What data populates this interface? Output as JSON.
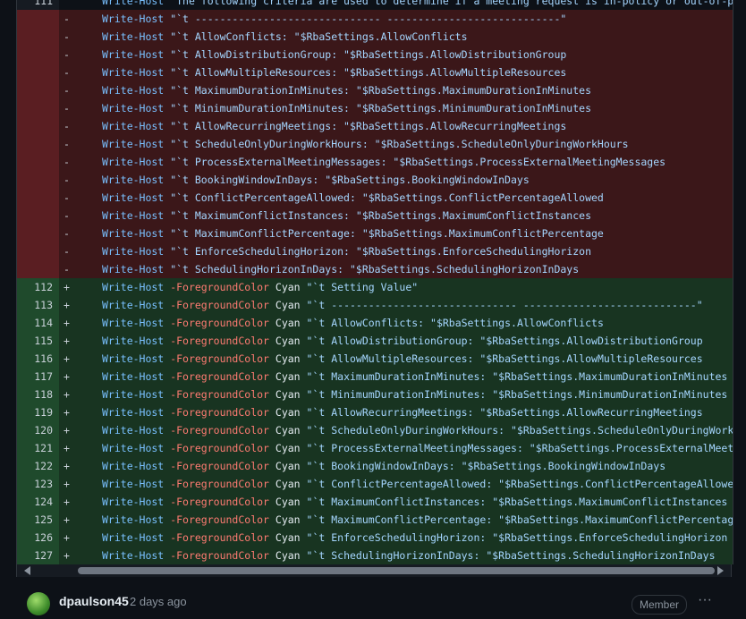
{
  "diff": {
    "rows": [
      {
        "type": "ctx",
        "num": "111",
        "sign": "",
        "cmd": "Write-Host",
        "param": "",
        "text": "",
        "str": "\"The following criteria are used to determine if a meeting request is in-policy or out-of-policy"
      },
      {
        "type": "del",
        "num": "",
        "sign": "-",
        "cmd": "Write-Host",
        "param": "",
        "text": "",
        "str": "\"`t ------------------------------  ----------------------------\""
      },
      {
        "type": "del",
        "num": "",
        "sign": "-",
        "cmd": "Write-Host",
        "param": "",
        "text": "",
        "str": "\"`t AllowConflicts:                 \"$RbaSettings.AllowConflicts"
      },
      {
        "type": "del",
        "num": "",
        "sign": "-",
        "cmd": "Write-Host",
        "param": "",
        "text": "",
        "str": "\"`t AllowDistributionGroup:         \"$RbaSettings.AllowDistributionGroup"
      },
      {
        "type": "del",
        "num": "",
        "sign": "-",
        "cmd": "Write-Host",
        "param": "",
        "text": "",
        "str": "\"`t AllowMultipleResources:         \"$RbaSettings.AllowMultipleResources"
      },
      {
        "type": "del",
        "num": "",
        "sign": "-",
        "cmd": "Write-Host",
        "param": "",
        "text": "",
        "str": "\"`t MaximumDurationInMinutes:       \"$RbaSettings.MaximumDurationInMinutes"
      },
      {
        "type": "del",
        "num": "",
        "sign": "-",
        "cmd": "Write-Host",
        "param": "",
        "text": "",
        "str": "\"`t MinimumDurationInMinutes:       \"$RbaSettings.MinimumDurationInMinutes"
      },
      {
        "type": "del",
        "num": "",
        "sign": "-",
        "cmd": "Write-Host",
        "param": "",
        "text": "",
        "str": "\"`t AllowRecurringMeetings:         \"$RbaSettings.AllowRecurringMeetings"
      },
      {
        "type": "del",
        "num": "",
        "sign": "-",
        "cmd": "Write-Host",
        "param": "",
        "text": "",
        "str": "\"`t ScheduleOnlyDuringWorkHours:    \"$RbaSettings.ScheduleOnlyDuringWorkHours"
      },
      {
        "type": "del",
        "num": "",
        "sign": "-",
        "cmd": "Write-Host",
        "param": "",
        "text": "",
        "str": "\"`t ProcessExternalMeetingMessages: \"$RbaSettings.ProcessExternalMeetingMessages"
      },
      {
        "type": "del",
        "num": "",
        "sign": "-",
        "cmd": "Write-Host",
        "param": "",
        "text": "",
        "str": "\"`t BookingWindowInDays:            \"$RbaSettings.BookingWindowInDays"
      },
      {
        "type": "del",
        "num": "",
        "sign": "-",
        "cmd": "Write-Host",
        "param": "",
        "text": "",
        "str": "\"`t ConflictPercentageAllowed:      \"$RbaSettings.ConflictPercentageAllowed"
      },
      {
        "type": "del",
        "num": "",
        "sign": "-",
        "cmd": "Write-Host",
        "param": "",
        "text": "",
        "str": "\"`t MaximumConflictInstances:       \"$RbaSettings.MaximumConflictInstances"
      },
      {
        "type": "del",
        "num": "",
        "sign": "-",
        "cmd": "Write-Host",
        "param": "",
        "text": "",
        "str": "\"`t MaximumConflictPercentage:      \"$RbaSettings.MaximumConflictPercentage"
      },
      {
        "type": "del",
        "num": "",
        "sign": "-",
        "cmd": "Write-Host",
        "param": "",
        "text": "",
        "str": "\"`t EnforceSchedulingHorizon:       \"$RbaSettings.EnforceSchedulingHorizon"
      },
      {
        "type": "del",
        "num": "",
        "sign": "-",
        "cmd": "Write-Host",
        "param": "",
        "text": "",
        "str": "\"`t SchedulingHorizonInDays:        \"$RbaSettings.SchedulingHorizonInDays"
      },
      {
        "type": "add",
        "num": "112",
        "sign": "+",
        "cmd": "Write-Host",
        "param": "-ForegroundColor",
        "text": "Cyan",
        "str": "\"`t Setting                        Value\""
      },
      {
        "type": "add",
        "num": "113",
        "sign": "+",
        "cmd": "Write-Host",
        "param": "-ForegroundColor",
        "text": "Cyan",
        "str": "\"`t ------------------------------  ----------------------------\""
      },
      {
        "type": "add",
        "num": "114",
        "sign": "+",
        "cmd": "Write-Host",
        "param": "-ForegroundColor",
        "text": "Cyan",
        "str": "\"`t AllowConflicts:                 \"$RbaSettings.AllowConflicts"
      },
      {
        "type": "add",
        "num": "115",
        "sign": "+",
        "cmd": "Write-Host",
        "param": "-ForegroundColor",
        "text": "Cyan",
        "str": "\"`t AllowDistributionGroup:         \"$RbaSettings.AllowDistributionGroup"
      },
      {
        "type": "add",
        "num": "116",
        "sign": "+",
        "cmd": "Write-Host",
        "param": "-ForegroundColor",
        "text": "Cyan",
        "str": "\"`t AllowMultipleResources:         \"$RbaSettings.AllowMultipleResources"
      },
      {
        "type": "add",
        "num": "117",
        "sign": "+",
        "cmd": "Write-Host",
        "param": "-ForegroundColor",
        "text": "Cyan",
        "str": "\"`t MaximumDurationInMinutes:       \"$RbaSettings.MaximumDurationInMinutes"
      },
      {
        "type": "add",
        "num": "118",
        "sign": "+",
        "cmd": "Write-Host",
        "param": "-ForegroundColor",
        "text": "Cyan",
        "str": "\"`t MinimumDurationInMinutes:       \"$RbaSettings.MinimumDurationInMinutes"
      },
      {
        "type": "add",
        "num": "119",
        "sign": "+",
        "cmd": "Write-Host",
        "param": "-ForegroundColor",
        "text": "Cyan",
        "str": "\"`t AllowRecurringMeetings:         \"$RbaSettings.AllowRecurringMeetings"
      },
      {
        "type": "add",
        "num": "120",
        "sign": "+",
        "cmd": "Write-Host",
        "param": "-ForegroundColor",
        "text": "Cyan",
        "str": "\"`t ScheduleOnlyDuringWorkHours:    \"$RbaSettings.ScheduleOnlyDuringWorkHours"
      },
      {
        "type": "add",
        "num": "121",
        "sign": "+",
        "cmd": "Write-Host",
        "param": "-ForegroundColor",
        "text": "Cyan",
        "str": "\"`t ProcessExternalMeetingMessages: \"$RbaSettings.ProcessExternalMeetingMessages"
      },
      {
        "type": "add",
        "num": "122",
        "sign": "+",
        "cmd": "Write-Host",
        "param": "-ForegroundColor",
        "text": "Cyan",
        "str": "\"`t BookingWindowInDays:            \"$RbaSettings.BookingWindowInDays"
      },
      {
        "type": "add",
        "num": "123",
        "sign": "+",
        "cmd": "Write-Host",
        "param": "-ForegroundColor",
        "text": "Cyan",
        "str": "\"`t ConflictPercentageAllowed:      \"$RbaSettings.ConflictPercentageAllowed"
      },
      {
        "type": "add",
        "num": "124",
        "sign": "+",
        "cmd": "Write-Host",
        "param": "-ForegroundColor",
        "text": "Cyan",
        "str": "\"`t MaximumConflictInstances:       \"$RbaSettings.MaximumConflictInstances"
      },
      {
        "type": "add",
        "num": "125",
        "sign": "+",
        "cmd": "Write-Host",
        "param": "-ForegroundColor",
        "text": "Cyan",
        "str": "\"`t MaximumConflictPercentage:      \"$RbaSettings.MaximumConflictPercentage"
      },
      {
        "type": "add",
        "num": "126",
        "sign": "+",
        "cmd": "Write-Host",
        "param": "-ForegroundColor",
        "text": "Cyan",
        "str": "\"`t EnforceSchedulingHorizon:       \"$RbaSettings.EnforceSchedulingHorizon"
      },
      {
        "type": "add",
        "num": "127",
        "sign": "+",
        "cmd": "Write-Host",
        "param": "-ForegroundColor",
        "text": "Cyan",
        "str": "\"`t SchedulingHorizonInDays:        \"$RbaSettings.SchedulingHorizonInDays"
      }
    ]
  },
  "comment": {
    "author": "dpaulson45",
    "time": "2 days ago",
    "badge": "Member",
    "more": "···"
  },
  "colors": {
    "deleted": "#3b1719",
    "added": "#183421",
    "keyword": "#79c0ff",
    "operator": "#ff7b72"
  }
}
